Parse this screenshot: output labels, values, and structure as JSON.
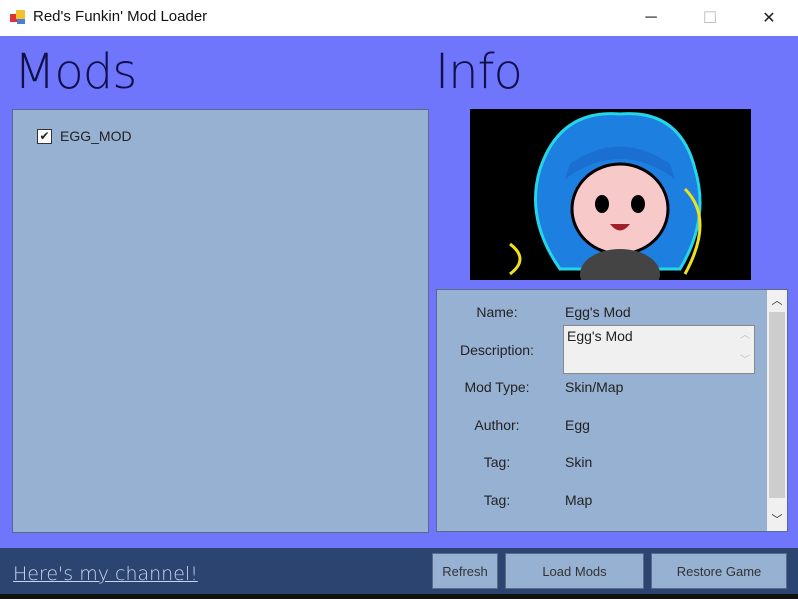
{
  "window": {
    "title": "Red's Funkin' Mod Loader",
    "minimize": "─",
    "maximize": "☐",
    "close": "✕"
  },
  "mods": {
    "heading": "Mods",
    "items": [
      {
        "label": "EGG_MOD",
        "checked": true
      }
    ]
  },
  "info": {
    "heading": "Info",
    "fields": {
      "name_label": "Name:",
      "name": "Egg's Mod",
      "description_label": "Description:",
      "description": "Egg's Mod",
      "mod_type_label": "Mod Type:",
      "mod_type": "Skin/Map",
      "author_label": "Author:",
      "author": "Egg",
      "tag1_label": "Tag:",
      "tag1": "Skin",
      "tag2_label": "Tag:",
      "tag2": "Map"
    }
  },
  "footer": {
    "channel_link": "Here's my channel!",
    "refresh": "Refresh",
    "load_mods": "Load Mods",
    "restore_game": "Restore Game"
  }
}
